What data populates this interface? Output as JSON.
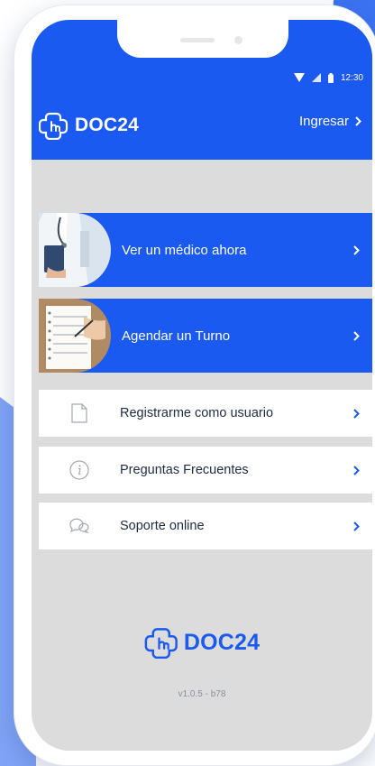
{
  "colors": {
    "brand_blue": "#1a5af0",
    "screen_bg": "#dcdcdc",
    "text_dark": "#1f2a44"
  },
  "status_bar": {
    "time": "12:30"
  },
  "header": {
    "brand": "DOC24",
    "login_label": "Ingresar",
    "login_icon": "chevron-right-icon"
  },
  "actions": [
    {
      "label": "Ver un médico ahora",
      "image": "doctor-photo"
    },
    {
      "label": "Agendar un Turno",
      "image": "notebook-photo"
    }
  ],
  "menu": [
    {
      "label": "Registrarme como usuario",
      "icon": "document-icon"
    },
    {
      "label": "Preguntas Frecuentes",
      "icon": "info-icon"
    },
    {
      "label": "Soporte online",
      "icon": "chat-bubbles-icon"
    }
  ],
  "footer": {
    "brand": "DOC24",
    "version": "v1.0.5 - b78"
  }
}
